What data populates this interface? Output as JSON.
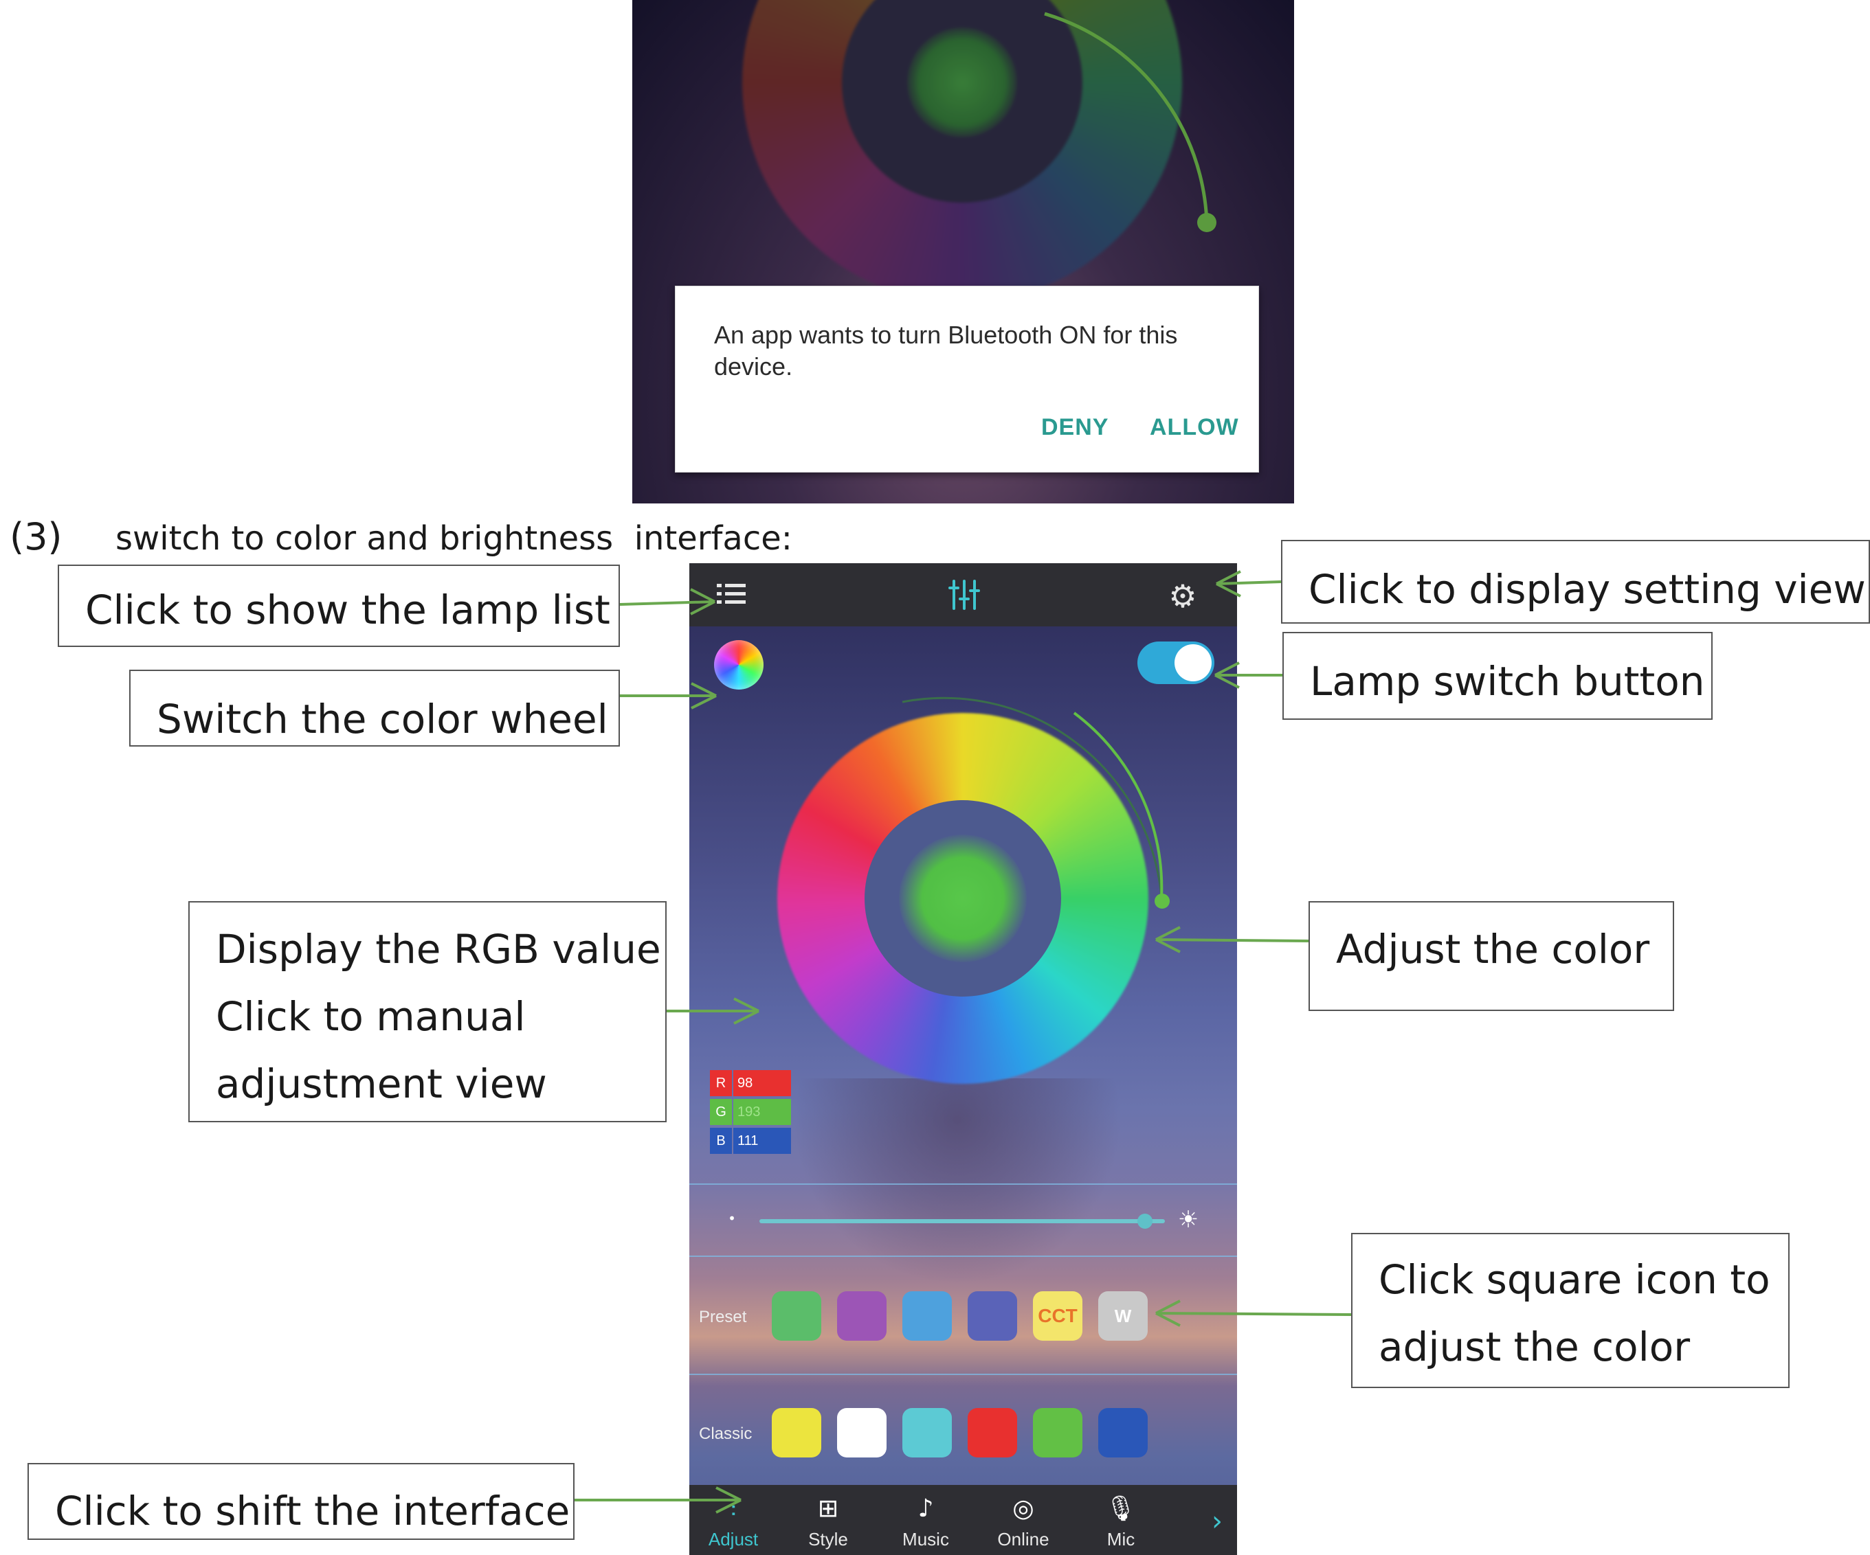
{
  "top_screenshot": {
    "dialog": {
      "message": "An app wants to turn Bluetooth ON for this device.",
      "deny_label": "DENY",
      "allow_label": "ALLOW"
    }
  },
  "caption": {
    "step_number": "(3)",
    "text": "switch to color and brightness  interface:"
  },
  "app": {
    "rgb": {
      "r_key": "R",
      "r_value": "98",
      "g_key": "G",
      "g_value": "193",
      "b_key": "B",
      "b_value": "111"
    },
    "brightness_level": 0.95,
    "preset": {
      "label": "Preset",
      "swatches": [
        {
          "color": "#5bbd6a",
          "text": ""
        },
        {
          "color": "#9c55b6",
          "text": ""
        },
        {
          "color": "#4ea1dd",
          "text": ""
        },
        {
          "color": "#5a63b8",
          "text": ""
        },
        {
          "color": "#f3e56b",
          "text": "CCT"
        },
        {
          "color": "#c9c9c9",
          "text": "W"
        }
      ]
    },
    "classic": {
      "label": "Classic",
      "swatches": [
        {
          "color": "#ece43e"
        },
        {
          "color": "#ffffff"
        },
        {
          "color": "#5ccad4"
        },
        {
          "color": "#e8302f"
        },
        {
          "color": "#62c045"
        },
        {
          "color": "#2a57b8"
        }
      ]
    },
    "tabs": [
      {
        "label": "Adjust",
        "icon": "equalizer-icon"
      },
      {
        "label": "Style",
        "icon": "grid-icon"
      },
      {
        "label": "Music",
        "icon": "music-note-icon"
      },
      {
        "label": "Online",
        "icon": "online-music-icon"
      },
      {
        "label": "Mic",
        "icon": "microphone-icon"
      }
    ]
  },
  "callouts": {
    "lamp_list": "Click to show the lamp list",
    "color_wheel": "Switch the color wheel",
    "settings": "Click to display  setting view",
    "lamp_switch": "Lamp switch button",
    "rgb_line1": "Display the RGB value",
    "rgb_line2": "Click to manual",
    "rgb_line3": "adjustment view",
    "adjust_color": "Adjust the color",
    "square_line1": "Click square icon to",
    "square_line2": "adjust the color",
    "shift_interface": "Click to shift the interface"
  }
}
